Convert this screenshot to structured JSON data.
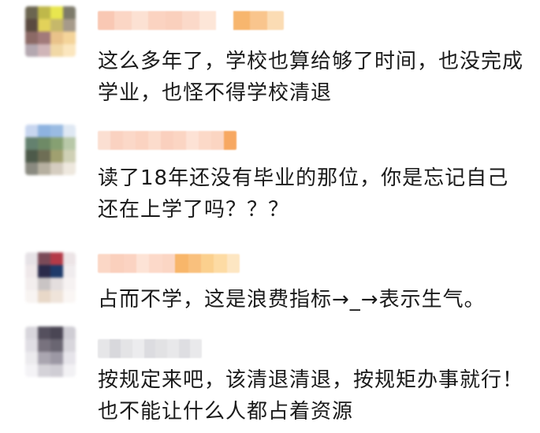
{
  "comments": [
    {
      "text": "这么多年了，学校也算给够了时间，也没完成学业，也怪不得学校清退",
      "avatar_colors": [
        "#6b6550",
        "#bfb84a",
        "#e8e64f",
        "#7d7a6a",
        "#5a4a40",
        "#e2d25a",
        "#c6b86a",
        "#a69a8a",
        "#8c6a66",
        "#a27a7a",
        "#e9c28a",
        "#f4d49a",
        "#b4a8b0",
        "#d0b5b8",
        "#f1d8a6",
        "#fbe6be"
      ],
      "name_colors": [
        "#f9c8b4",
        "#fbd6c5",
        "#fce1d3",
        "#fbd3c1",
        "#fad0bd",
        "#fbd9c9",
        "#fde6d8",
        "#ffffff",
        "#f7b66e",
        "#f9c58d",
        "#fbdcb4"
      ]
    },
    {
      "text": "读了18年还没有毕业的那位，你是忘记自己还在上学了吗？？？",
      "avatar_colors": [
        "#c8d6ef",
        "#8eb3e0",
        "#9abbe2",
        "#dfe8f3",
        "#64816f",
        "#6e8a66",
        "#86a072",
        "#b8c8a8",
        "#4d5a4a",
        "#6e6e55",
        "#a0a070",
        "#cfd0b5",
        "#8a8a80",
        "#b6b0a0",
        "#d5cdc0",
        "#eee8de"
      ],
      "name_colors": [
        "#fbdfd2",
        "#fad2c1",
        "#fbd8c8",
        "#fbd3c1",
        "#fcdccc",
        "#fad0be",
        "#fbd5c3",
        "#fde2d5",
        "#fcd9c8",
        "#fbd5c2",
        "#f7a862"
      ]
    },
    {
      "text": "占而不学，这是浪费指标→_→表示生气。",
      "avatar_colors": [
        "#e6e2e6",
        "#7a4a58",
        "#b43a48",
        "#ece4e6",
        "#efe8ea",
        "#2a2a4a",
        "#1e3a6a",
        "#f0ecee",
        "#f3eeee",
        "#c9c4c4",
        "#e4dede",
        "#f6f2f2",
        "#f8f4f2",
        "#e8d8c8",
        "#efe4da",
        "#faf6f4"
      ],
      "name_colors": [
        "#fbd7c6",
        "#fad0bd",
        "#fbd3c2",
        "#fde3d6",
        "#fcd9c9",
        "#fbd6c4",
        "#f8b66a",
        "#f9c07d",
        "#fbd08e",
        "#fddba4",
        "#fde6c2"
      ]
    },
    {
      "text": "按规定来吧，该清退清退，按规矩办事就行！也不能让什么人都占着资源",
      "avatar_colors": [
        "#d8d6dc",
        "#55505e",
        "#4a4654",
        "#cfcdd4",
        "#e0dee4",
        "#78727e",
        "#6a6672",
        "#d8d6dc",
        "#ecebee",
        "#aaa6b0",
        "#9c98a4",
        "#e6e4ea",
        "#f4f3f6",
        "#d4d2d8",
        "#cfcdd4",
        "#f2f1f4"
      ],
      "name_colors": [
        "#e6e6e8",
        "#d8d8dc",
        "#e4e4e6",
        "#ececee",
        "#dcdce0",
        "#e2e2e4",
        "#e8e8ea",
        "#dedee2",
        "#e9e9eb"
      ]
    }
  ]
}
